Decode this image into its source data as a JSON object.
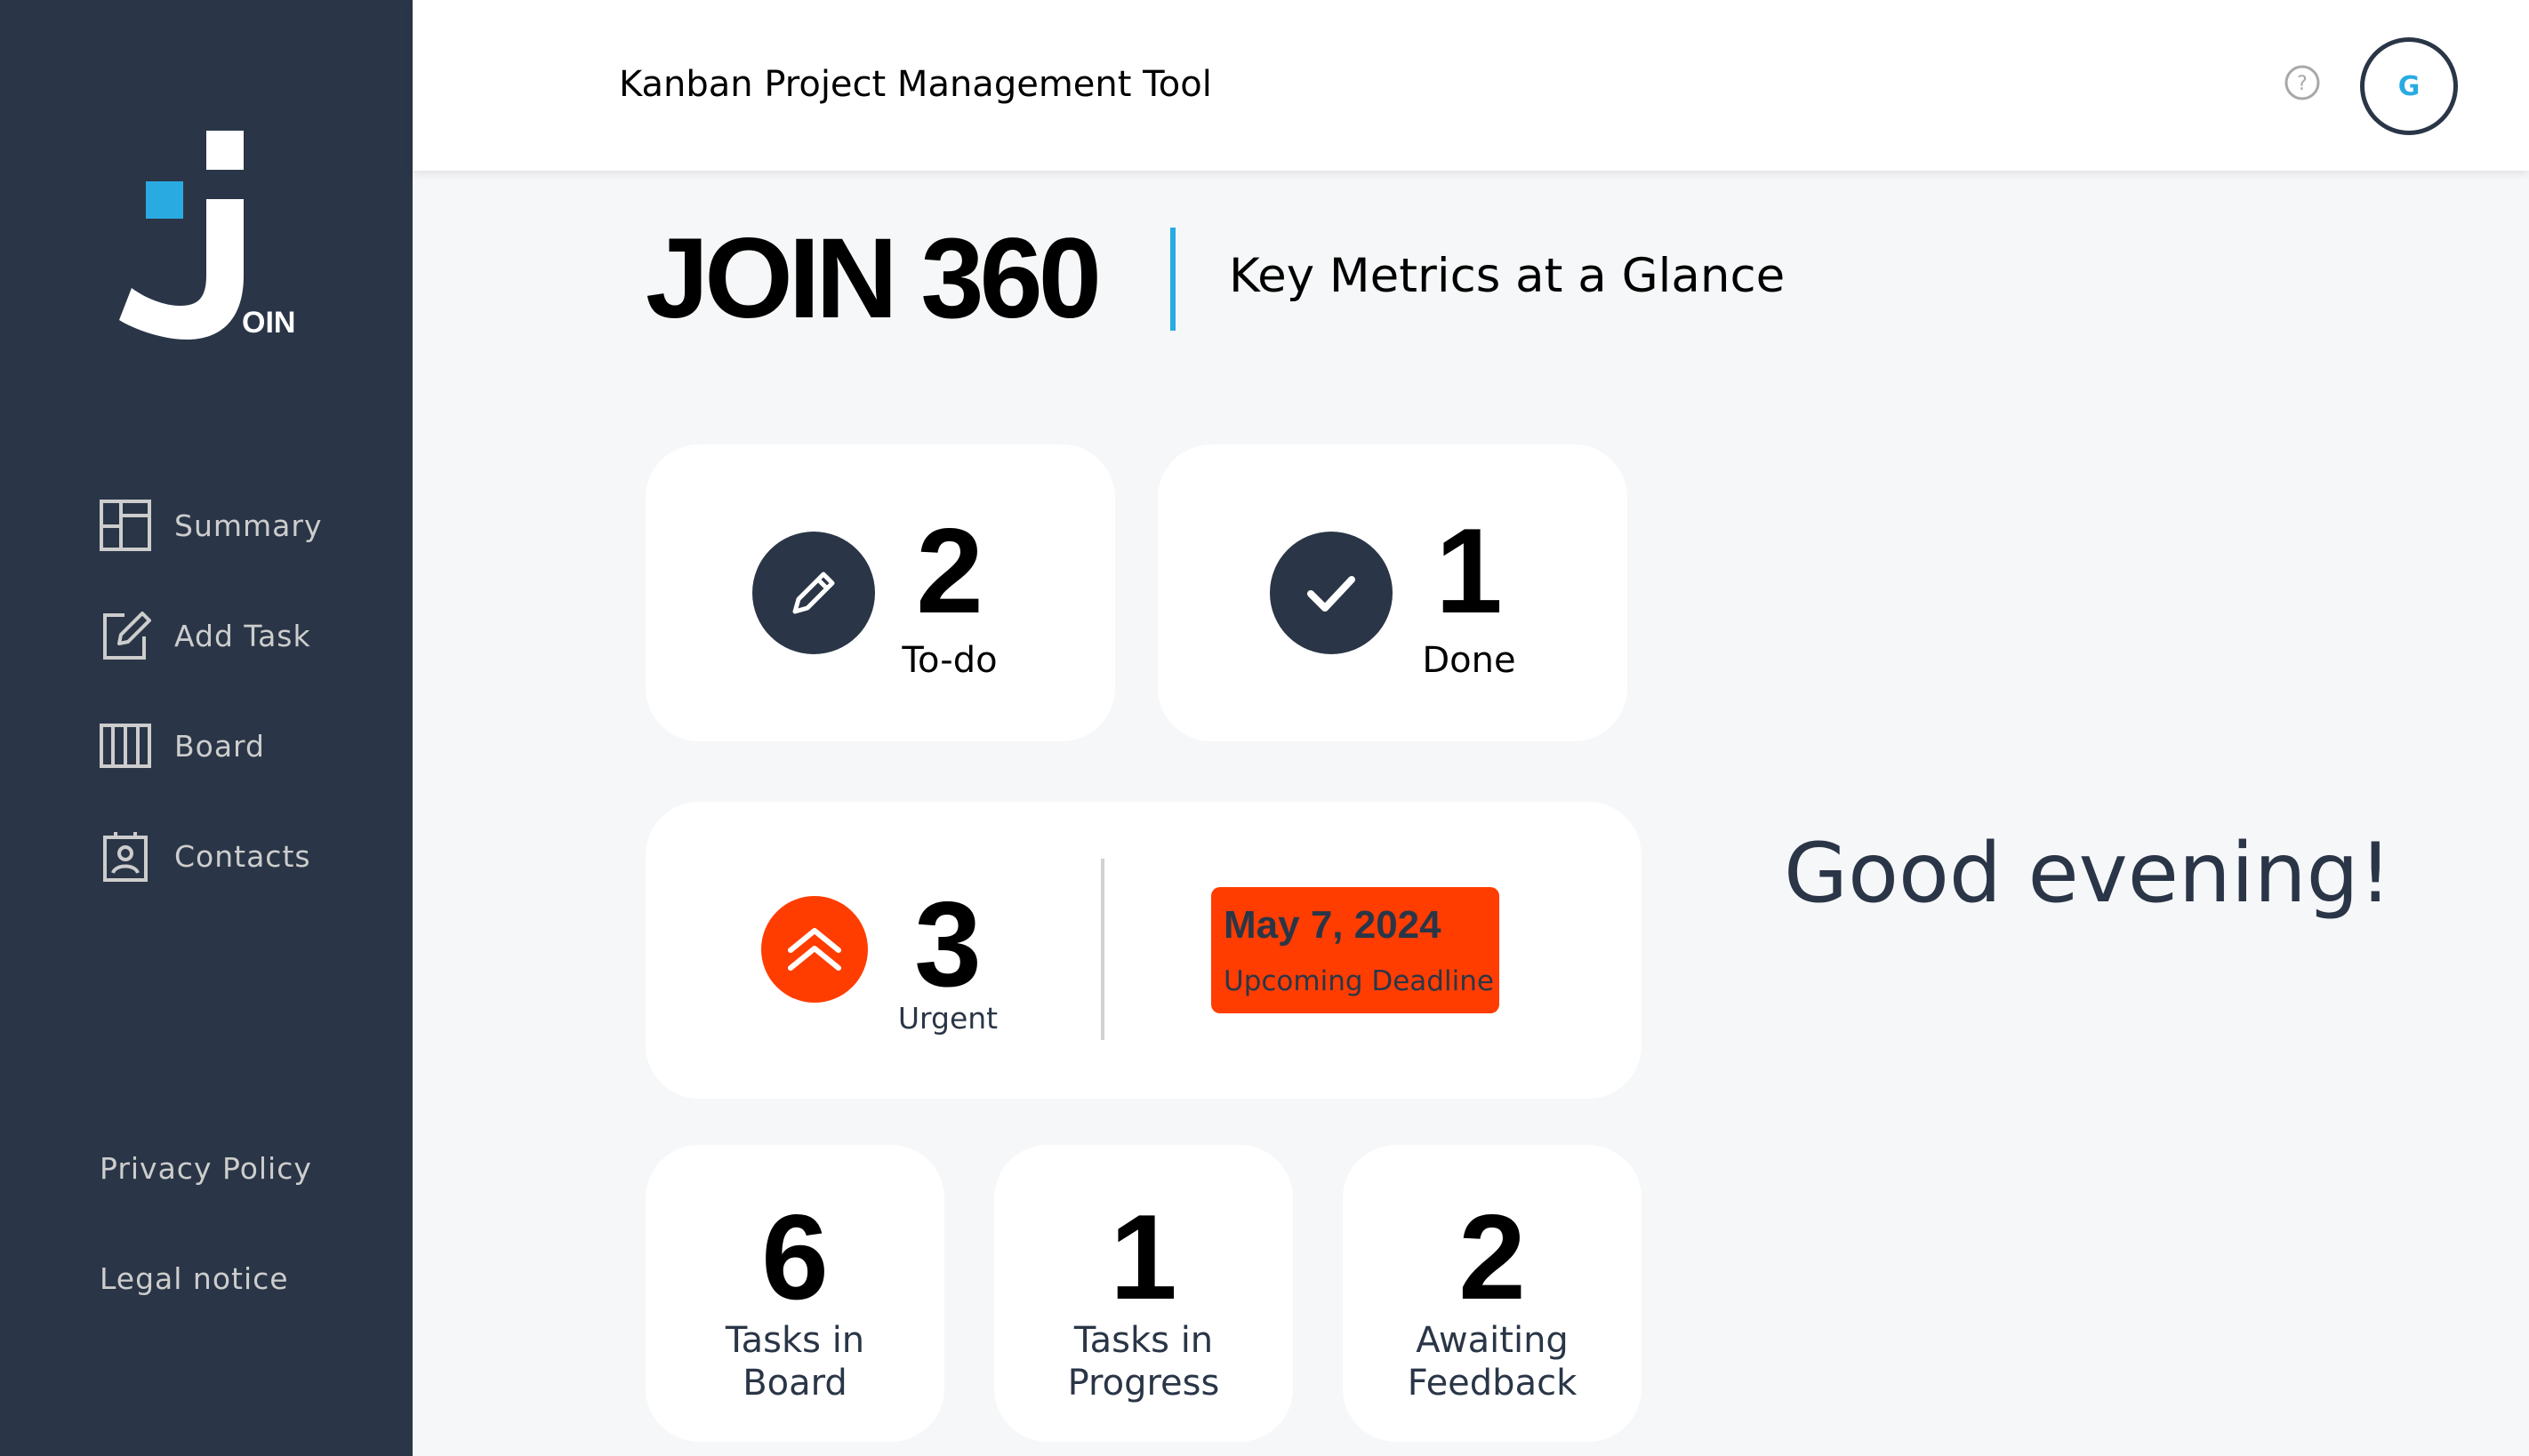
{
  "sidebar": {
    "logo_text": "OIN",
    "nav": [
      {
        "label": "Summary",
        "icon": "summary-icon"
      },
      {
        "label": "Add Task",
        "icon": "add-task-icon"
      },
      {
        "label": "Board",
        "icon": "board-icon"
      },
      {
        "label": "Contacts",
        "icon": "contacts-icon"
      }
    ],
    "footer": [
      "Privacy Policy",
      "Legal notice"
    ]
  },
  "header": {
    "title": "Kanban Project Management Tool",
    "help_icon": "help-icon",
    "user_initial": "G"
  },
  "page": {
    "title": "JOIN 360",
    "subtitle": "Key Metrics at a Glance",
    "greeting": "Good evening!"
  },
  "metrics": {
    "todo": {
      "value": "2",
      "label": "To-do"
    },
    "done": {
      "value": "1",
      "label": "Done"
    },
    "urgent": {
      "value": "3",
      "label": "Urgent"
    },
    "deadline": {
      "date": "May 7, 2024",
      "label": "Upcoming Deadline"
    },
    "tasks_board": {
      "value": "6",
      "label": "Tasks in Board"
    },
    "tasks_progress": {
      "value": "1",
      "label": "Tasks in Progress"
    },
    "awaiting_feedback": {
      "value": "2",
      "label": "Awaiting Feedback"
    }
  },
  "colors": {
    "sidebar": "#2A3647",
    "accent": "#29ABE2",
    "urgent": "#FF3D00",
    "background": "#F6F7F8"
  }
}
